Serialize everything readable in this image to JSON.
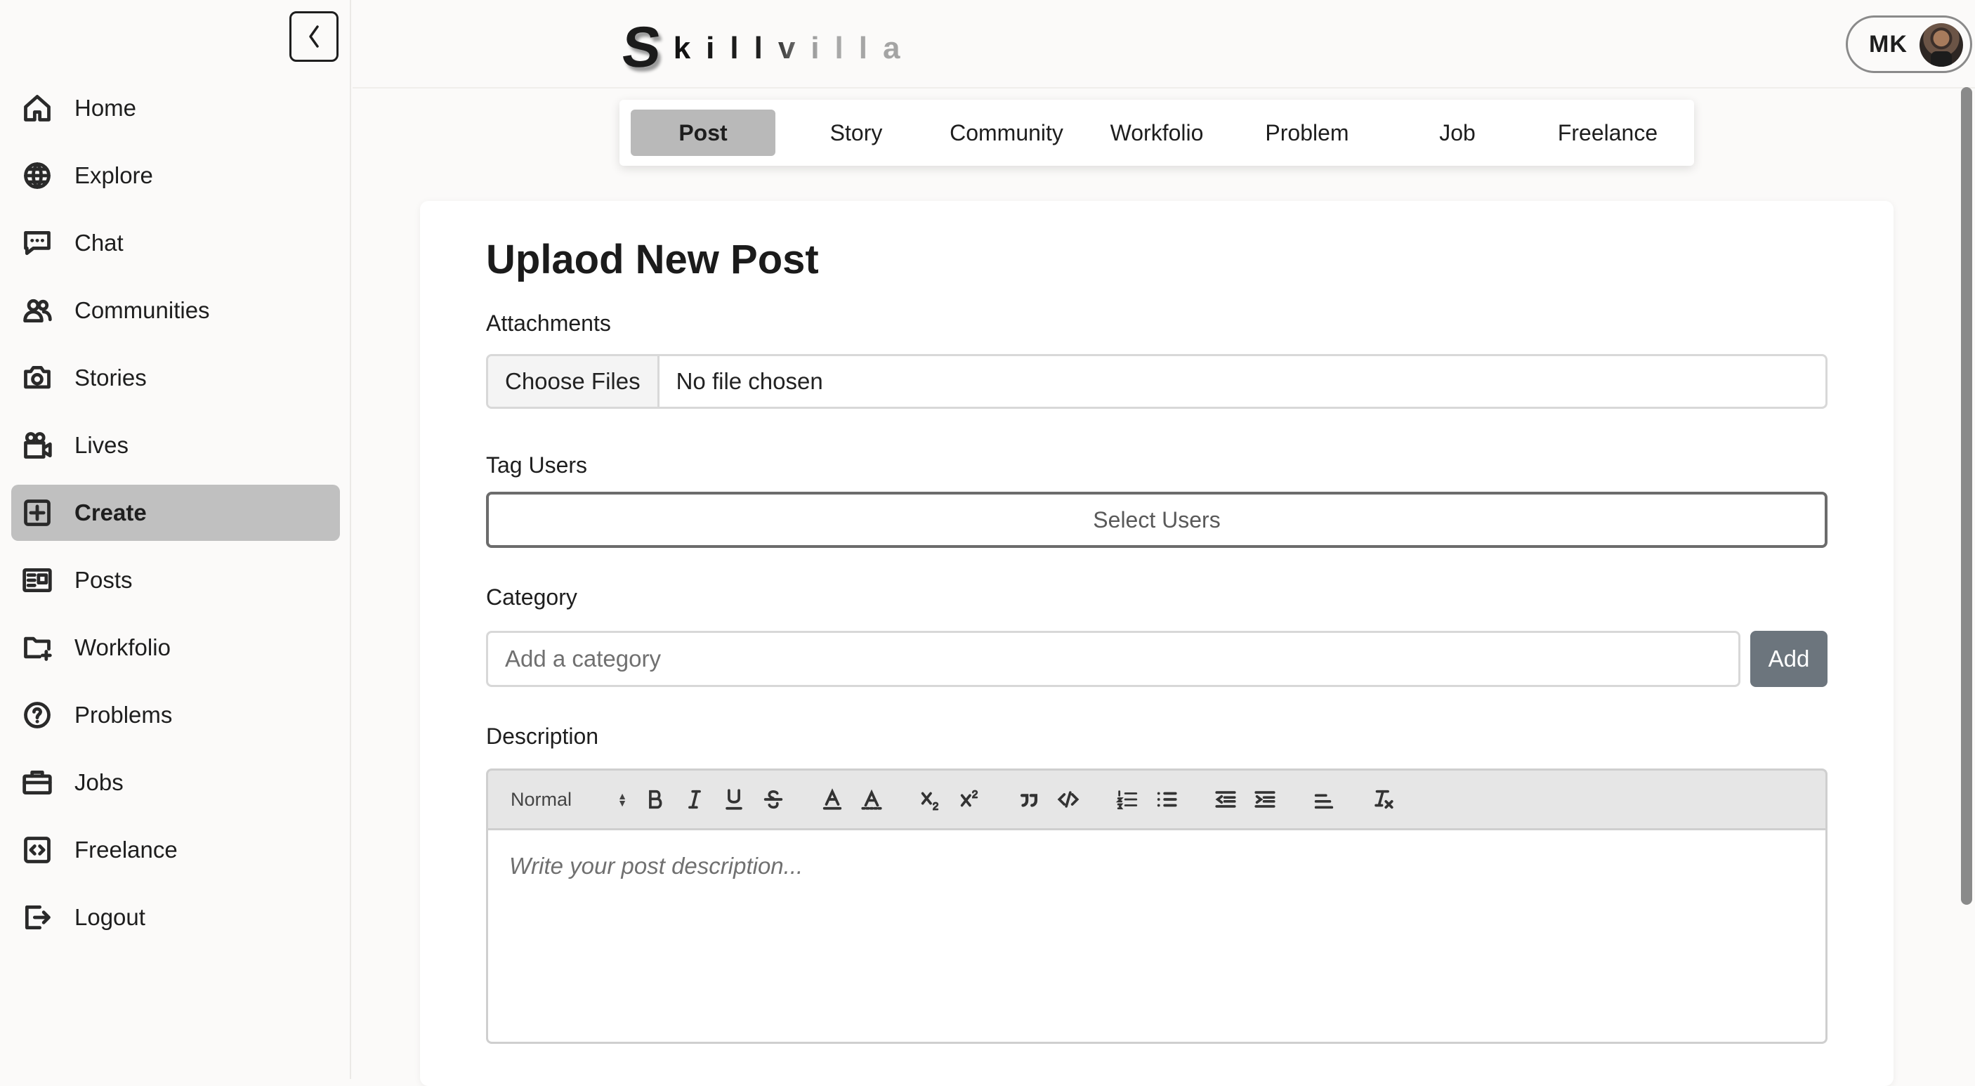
{
  "sidebar": {
    "items": [
      {
        "label": "Home",
        "icon": "home-icon"
      },
      {
        "label": "Explore",
        "icon": "globe-icon"
      },
      {
        "label": "Chat",
        "icon": "chat-icon"
      },
      {
        "label": "Communities",
        "icon": "users-icon"
      },
      {
        "label": "Stories",
        "icon": "camera-icon"
      },
      {
        "label": "Lives",
        "icon": "video-icon"
      },
      {
        "label": "Create",
        "icon": "plus-square-icon",
        "active": true
      },
      {
        "label": "Posts",
        "icon": "newspaper-icon"
      },
      {
        "label": "Workfolio",
        "icon": "folder-plus-icon"
      },
      {
        "label": "Problems",
        "icon": "question-circle-icon"
      },
      {
        "label": "Jobs",
        "icon": "briefcase-icon"
      },
      {
        "label": "Freelance",
        "icon": "code-square-icon"
      },
      {
        "label": "Logout",
        "icon": "logout-icon"
      }
    ]
  },
  "header": {
    "logo_initial": "S",
    "logo_rest": "killvilla",
    "user_initials": "MK"
  },
  "tabs": [
    "Post",
    "Story",
    "Community",
    "Workfolio",
    "Problem",
    "Job",
    "Freelance"
  ],
  "form": {
    "title": "Uplaod New Post",
    "attachments_label": "Attachments",
    "choose_files": "Choose Files",
    "file_status": "No file chosen",
    "tag_users_label": "Tag Users",
    "select_users": "Select Users",
    "category_label": "Category",
    "category_placeholder": "Add a category",
    "add_button": "Add",
    "description_label": "Description",
    "format_select": "Normal",
    "description_placeholder": "Write your post description..."
  },
  "colors": {
    "active_bg": "#c0c0c0",
    "add_button_bg": "#6c757d",
    "page_bg": "#fbfaf9"
  }
}
